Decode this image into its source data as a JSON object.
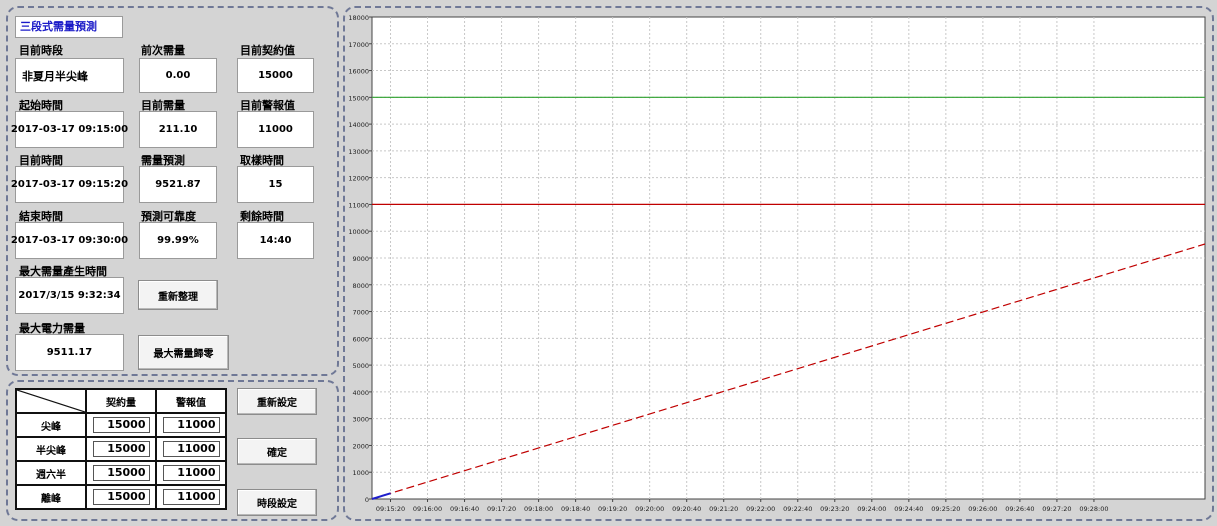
{
  "panel_title": "三段式需量預測",
  "fields": {
    "period_label": "目前時段",
    "period_value": "非夏月半尖峰",
    "prev_demand_label": "前次需量",
    "prev_demand_value": "0.00",
    "contract_label": "目前契約值",
    "contract_value": "15000",
    "start_time_label": "起始時間",
    "start_time_value": "2017-03-17 09:15:00",
    "cur_demand_label": "目前需量",
    "cur_demand_value": "211.10",
    "alarm_label": "目前警報值",
    "alarm_value": "11000",
    "cur_time_label": "目前時間",
    "cur_time_value": "2017-03-17 09:15:20",
    "forecast_label": "需量預測",
    "forecast_value": "9521.87",
    "sample_label": "取樣時間",
    "sample_value": "15",
    "end_time_label": "結束時間",
    "end_time_value": "2017-03-17 09:30:00",
    "reliability_label": "預測可靠度",
    "reliability_value": "99.99%",
    "remain_label": "剩餘時間",
    "remain_value": "14:40",
    "max_demand_time_label": "最大需量產生時間",
    "max_demand_time_value": "2017/3/15 9:32:34",
    "max_power_label": "最大電力需量",
    "max_power_value": "9511.17"
  },
  "buttons": {
    "refresh": "重新整理",
    "reset_max": "最大需量歸零",
    "reset_settings": "重新設定",
    "confirm": "確定",
    "period_settings": "時段設定"
  },
  "rate_table": {
    "headers": [
      "契約量",
      "警報值"
    ],
    "rows": [
      {
        "name": "尖峰",
        "contract": "15000",
        "alarm": "11000"
      },
      {
        "name": "半尖峰",
        "contract": "15000",
        "alarm": "11000"
      },
      {
        "name": "週六半",
        "contract": "15000",
        "alarm": "11000"
      },
      {
        "name": "離峰",
        "contract": "15000",
        "alarm": "11000"
      }
    ]
  },
  "chart_data": {
    "type": "line",
    "ylim": [
      0,
      18000
    ],
    "yticks": [
      0,
      1000,
      2000,
      3000,
      4000,
      5000,
      6000,
      7000,
      8000,
      9000,
      10000,
      11000,
      12000,
      13000,
      14000,
      15000,
      16000,
      17000,
      18000
    ],
    "xlim": [
      "09:15:00",
      "09:30:00"
    ],
    "xticks": [
      "09:15:20",
      "09:16:00",
      "09:16:40",
      "09:17:20",
      "09:18:00",
      "09:18:40",
      "09:19:20",
      "09:20:00",
      "09:20:40",
      "09:21:20",
      "09:22:00",
      "09:22:40",
      "09:23:20",
      "09:24:00",
      "09:24:40",
      "09:25:20",
      "09:26:00",
      "09:26:40",
      "09:27:20",
      "09:28:00"
    ],
    "grid": true,
    "series": [
      {
        "color": "#2ca02c",
        "style": "solid",
        "x": [
          "09:15:00",
          "09:30:00"
        ],
        "y": [
          15000,
          15000
        ]
      },
      {
        "color": "#c00000",
        "style": "solid",
        "x": [
          "09:15:00",
          "09:30:00"
        ],
        "y": [
          11000,
          11000
        ]
      },
      {
        "color": "#c00000",
        "style": "dashed",
        "x": [
          "09:15:00",
          "09:30:00"
        ],
        "y": [
          0,
          9521.87
        ]
      },
      {
        "color": "#1f1fcc",
        "style": "solid",
        "x": [
          "09:15:00",
          "09:15:20"
        ],
        "y": [
          0,
          211.1
        ]
      }
    ]
  }
}
